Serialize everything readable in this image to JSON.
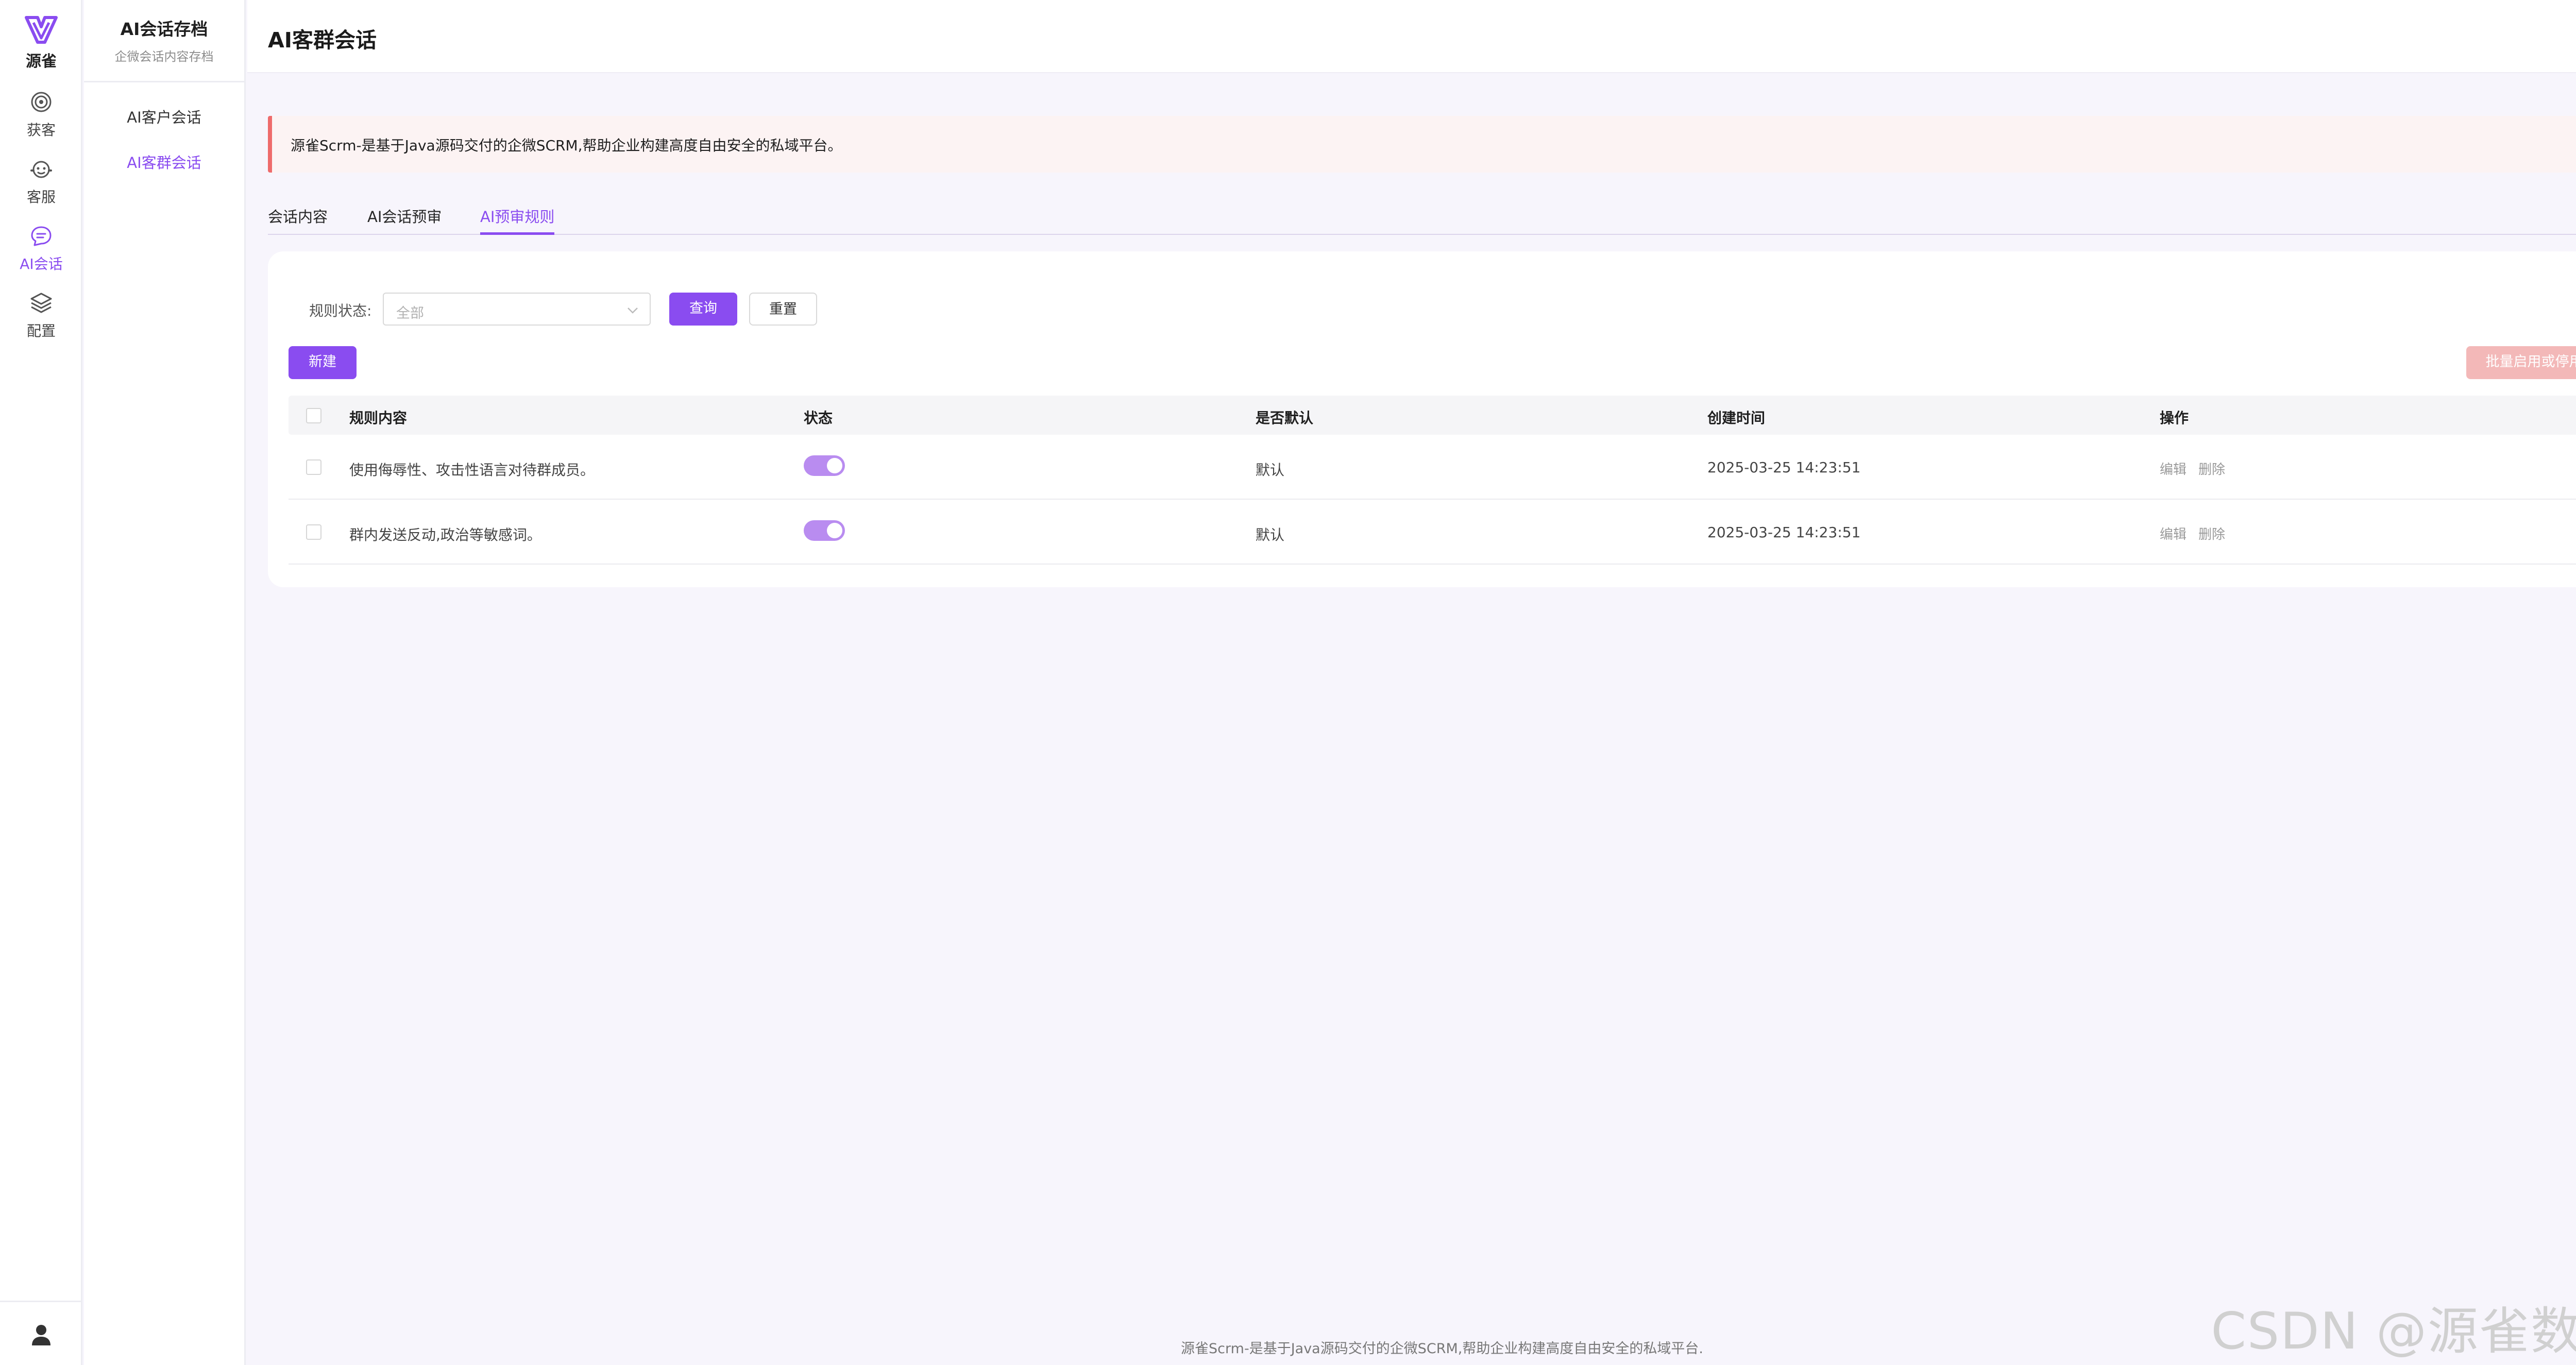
{
  "brand": {
    "name": "源雀",
    "accent": "#8a4cf0"
  },
  "rail": {
    "items": [
      {
        "label": "获客",
        "icon": "target-icon"
      },
      {
        "label": "客服",
        "icon": "agent-face-icon"
      },
      {
        "label": "AI会话",
        "icon": "chat-bubble-icon",
        "active": true
      },
      {
        "label": "配置",
        "icon": "layers-icon"
      }
    ],
    "user_icon": "user-icon"
  },
  "subnav": {
    "title": "AI会话存档",
    "subtitle": "企微会话内容存档",
    "items": [
      {
        "label": "AI客户会话"
      },
      {
        "label": "AI客群会话",
        "active": true
      }
    ]
  },
  "page": {
    "title": "AI客群会话"
  },
  "notice": {
    "text": "源雀Scrm-是基于Java源码交付的企微SCRM,帮助企业构建高度自由安全的私域平台。",
    "color": "#ee6b6b"
  },
  "tabs": [
    {
      "label": "会话内容"
    },
    {
      "label": "AI会话预审"
    },
    {
      "label": "AI预审规则",
      "active": true
    }
  ],
  "filter": {
    "status_label": "规则状态:",
    "status_value": "全部",
    "query_label": "查询",
    "reset_label": "重置"
  },
  "actions": {
    "new_label": "新建",
    "batch_label": "批量启用或停用"
  },
  "table": {
    "columns": [
      "规则内容",
      "状态",
      "是否默认",
      "创建时间",
      "操作"
    ],
    "rows": [
      {
        "content": "使用侮辱性、攻击性语言对待群成员。",
        "status_on": true,
        "default": "默认",
        "created": "2025-03-25 14:23:51",
        "edit": "编辑",
        "delete": "删除"
      },
      {
        "content": "群内发送反动,政治等敏感词。",
        "status_on": true,
        "default": "默认",
        "created": "2025-03-25 14:23:51",
        "edit": "编辑",
        "delete": "删除"
      }
    ]
  },
  "footer": {
    "text": "源雀Scrm-是基于Java源码交付的企微SCRM,帮助企业构建高度自由安全的私域平台."
  },
  "watermark": {
    "text": "CSDN @源雀数智"
  }
}
